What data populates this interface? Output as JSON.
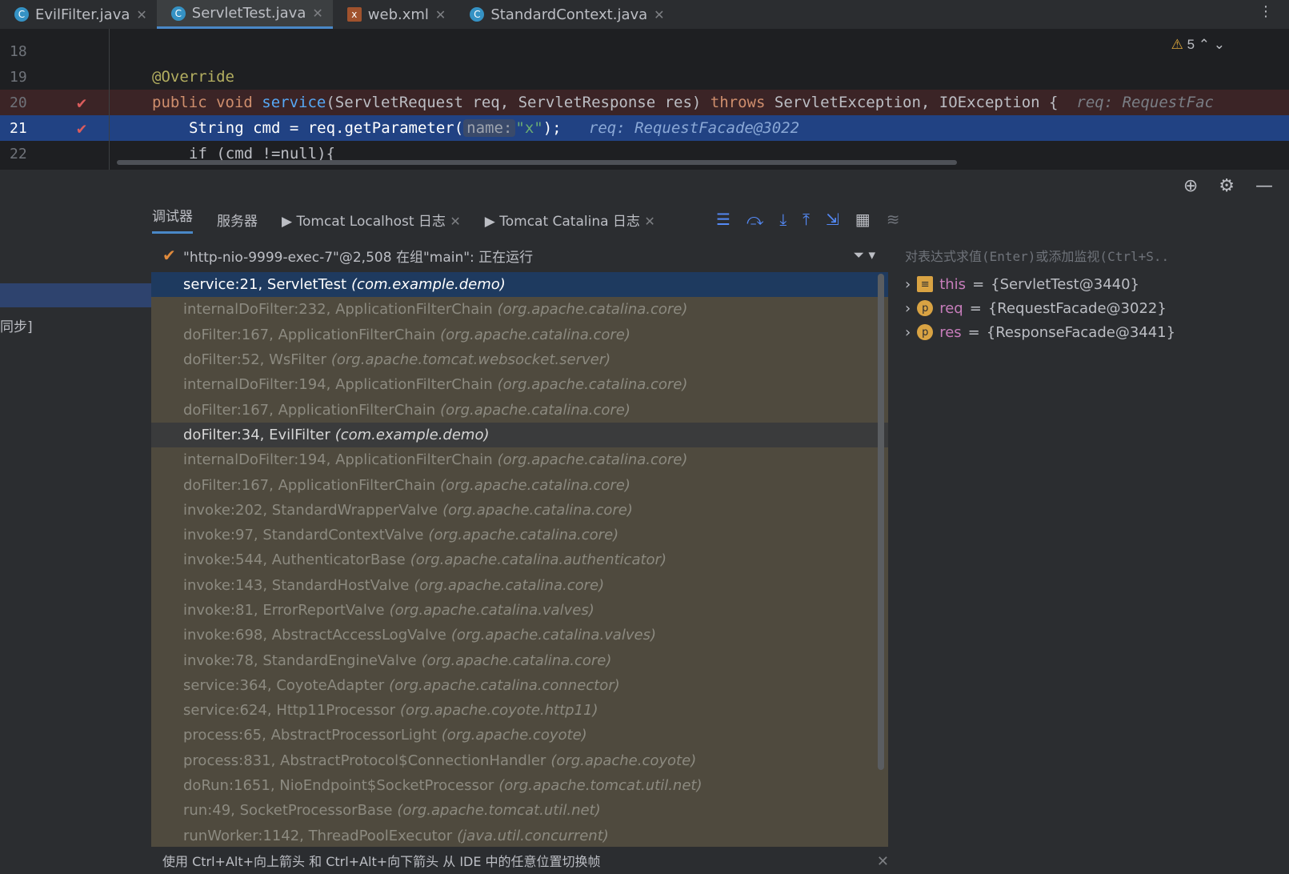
{
  "tabs": [
    {
      "label": "EvilFilter.java",
      "icon": "java-class-icon"
    },
    {
      "label": "ServletTest.java",
      "icon": "java-class-icon"
    },
    {
      "label": "web.xml",
      "icon": "xml-file-icon"
    },
    {
      "label": "StandardContext.java",
      "icon": "java-class-icon"
    }
  ],
  "editor": {
    "lines": [
      {
        "num": "18",
        "text": ""
      },
      {
        "num": "19",
        "text": "@Override"
      },
      {
        "num": "20",
        "text_kw": "public void ",
        "text_fn": "service",
        "text_rest": "(ServletRequest req, ServletResponse res) ",
        "text_kw2": "throws",
        "text_rest2": " ServletException, IOException {",
        "hint": "req: RequestFac"
      },
      {
        "num": "21",
        "pre": "String cmd = req.getParameter(",
        "param_hint": "name:",
        "str": "\"x\"",
        "post": ");",
        "hint": "req: RequestFacade@3022"
      },
      {
        "num": "22",
        "text": "if (cmd !=null){"
      }
    ],
    "warnings": "5"
  },
  "debug": {
    "tabs": [
      "调试器",
      "服务器",
      "Tomcat Localhost 日志",
      "Tomcat Catalina 日志"
    ],
    "thread": "\"http-nio-9999-exec-7\"@2,508 在组\"main\": 正在运行",
    "left_label": "同步]",
    "frames": [
      {
        "m": "service:21, ServletTest",
        "p": "(com.example.demo)"
      },
      {
        "m": "internalDoFilter:232, ApplicationFilterChain",
        "p": "(org.apache.catalina.core)"
      },
      {
        "m": "doFilter:167, ApplicationFilterChain",
        "p": "(org.apache.catalina.core)"
      },
      {
        "m": "doFilter:52, WsFilter",
        "p": "(org.apache.tomcat.websocket.server)"
      },
      {
        "m": "internalDoFilter:194, ApplicationFilterChain",
        "p": "(org.apache.catalina.core)"
      },
      {
        "m": "doFilter:167, ApplicationFilterChain",
        "p": "(org.apache.catalina.core)"
      },
      {
        "m": "doFilter:34, EvilFilter",
        "p": "(com.example.demo)"
      },
      {
        "m": "internalDoFilter:194, ApplicationFilterChain",
        "p": "(org.apache.catalina.core)"
      },
      {
        "m": "doFilter:167, ApplicationFilterChain",
        "p": "(org.apache.catalina.core)"
      },
      {
        "m": "invoke:202, StandardWrapperValve",
        "p": "(org.apache.catalina.core)"
      },
      {
        "m": "invoke:97, StandardContextValve",
        "p": "(org.apache.catalina.core)"
      },
      {
        "m": "invoke:544, AuthenticatorBase",
        "p": "(org.apache.catalina.authenticator)"
      },
      {
        "m": "invoke:143, StandardHostValve",
        "p": "(org.apache.catalina.core)"
      },
      {
        "m": "invoke:81, ErrorReportValve",
        "p": "(org.apache.catalina.valves)"
      },
      {
        "m": "invoke:698, AbstractAccessLogValve",
        "p": "(org.apache.catalina.valves)"
      },
      {
        "m": "invoke:78, StandardEngineValve",
        "p": "(org.apache.catalina.core)"
      },
      {
        "m": "service:364, CoyoteAdapter",
        "p": "(org.apache.catalina.connector)"
      },
      {
        "m": "service:624, Http11Processor",
        "p": "(org.apache.coyote.http11)"
      },
      {
        "m": "process:65, AbstractProcessorLight",
        "p": "(org.apache.coyote)"
      },
      {
        "m": "process:831, AbstractProtocol$ConnectionHandler",
        "p": "(org.apache.coyote)"
      },
      {
        "m": "doRun:1651, NioEndpoint$SocketProcessor",
        "p": "(org.apache.tomcat.util.net)"
      },
      {
        "m": "run:49, SocketProcessorBase",
        "p": "(org.apache.tomcat.util.net)"
      },
      {
        "m": "runWorker:1142, ThreadPoolExecutor",
        "p": "(java.util.concurrent)"
      }
    ],
    "expr_placeholder": "对表达式求值(Enter)或添加监视(Ctrl+S..",
    "vars": [
      {
        "badge": "≡",
        "name": "this",
        "value": "{ServletTest@3440}"
      },
      {
        "badge": "p",
        "name": "req",
        "value": "{RequestFacade@3022}"
      },
      {
        "badge": "p",
        "name": "res",
        "value": "{ResponseFacade@3441}"
      }
    ],
    "status": "使用 Ctrl+Alt+向上箭头 和 Ctrl+Alt+向下箭头 从 IDE 中的任意位置切换帧"
  }
}
